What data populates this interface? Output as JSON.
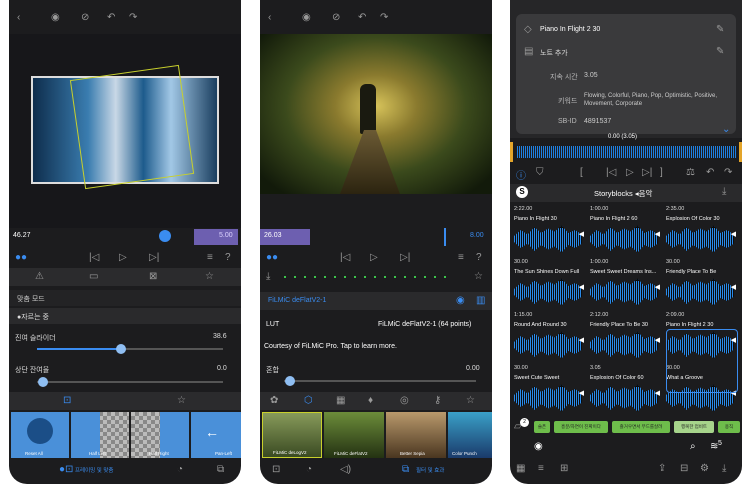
{
  "p1": {
    "time_left": "46.27",
    "time_right": "5.00",
    "section_mode": "맞춤 모드",
    "section_sub": "●자르는 중",
    "slider1_label": "진여 슬라이더",
    "slider1_value": "38.6",
    "slider1_fill": 0.45,
    "slider2_label": "상단 잔여율",
    "slider2_value": "0.0",
    "slider2_fill": 0.03,
    "thumbs": [
      "Reset All",
      "Half Left",
      "Half Right",
      "Pan-Left"
    ],
    "bottom_label": "프레이밍 및 맞춤"
  },
  "p2": {
    "time_left": "26.03",
    "time_right": "8.00",
    "filter_title": "FiLMiC deFlatV2-1",
    "lut_label": "LUT",
    "lut_value": "FiLMiC deFlatV2-1 (64 points)",
    "courtesy": "Courtesy of FiLMiC Pro. Tap to learn more.",
    "mix_label": "혼합",
    "mix_value": "0.00",
    "mix_fill": 0.03,
    "thumbs": [
      "FiLMiC deLogV2",
      "FiLMiC deFlatV2",
      "Better Sepia",
      "Color Punch"
    ],
    "bottom_label": "필터 및 효과"
  },
  "p3": {
    "title_line": "Piano In Flight 2 30",
    "note_label": "노트 추가",
    "meta": [
      {
        "k": "지속 시간",
        "v": "3.05"
      },
      {
        "k": "키워드",
        "v": "Flowing, Colorful, Piano, Pop, Optimistic, Positive, Movement, Corporate"
      },
      {
        "k": "SB-ID",
        "v": "4891537"
      }
    ],
    "scrub_label": "0.00 (3.05)",
    "header": "Storyblocks ◂음악",
    "cells": [
      {
        "t": "2:22.00",
        "n": "Piano In Flight 30"
      },
      {
        "t": "1:00.00",
        "n": "Piano In Flight 2 60"
      },
      {
        "t": "2:35.00",
        "n": "Explosion Of Color 30"
      },
      {
        "t": "30.00",
        "n": "The Sun Shines Down Full"
      },
      {
        "t": "1:00.00",
        "n": "Sweet Sweet Dreams Ins..."
      },
      {
        "t": "30.00",
        "n": "Friendly Place To Be"
      },
      {
        "t": "1:15.00",
        "n": "Round And Round 30"
      },
      {
        "t": "2:12.00",
        "n": "Friendly Place To Be 30"
      },
      {
        "t": "2:09.00",
        "n": "Piano In Flight 2 30"
      },
      {
        "t": "30.00",
        "n": "Sweet Cute Sweet"
      },
      {
        "t": "3.05",
        "n": "Explosion Of Color 60"
      },
      {
        "t": "30.00",
        "n": "What a Groove"
      }
    ],
    "tags": [
      "슬픈",
      "흥분/자연이 진짜이다",
      "즐거우면서 무드를살려",
      "행복한 업비트",
      "용직"
    ],
    "badge": "5"
  }
}
